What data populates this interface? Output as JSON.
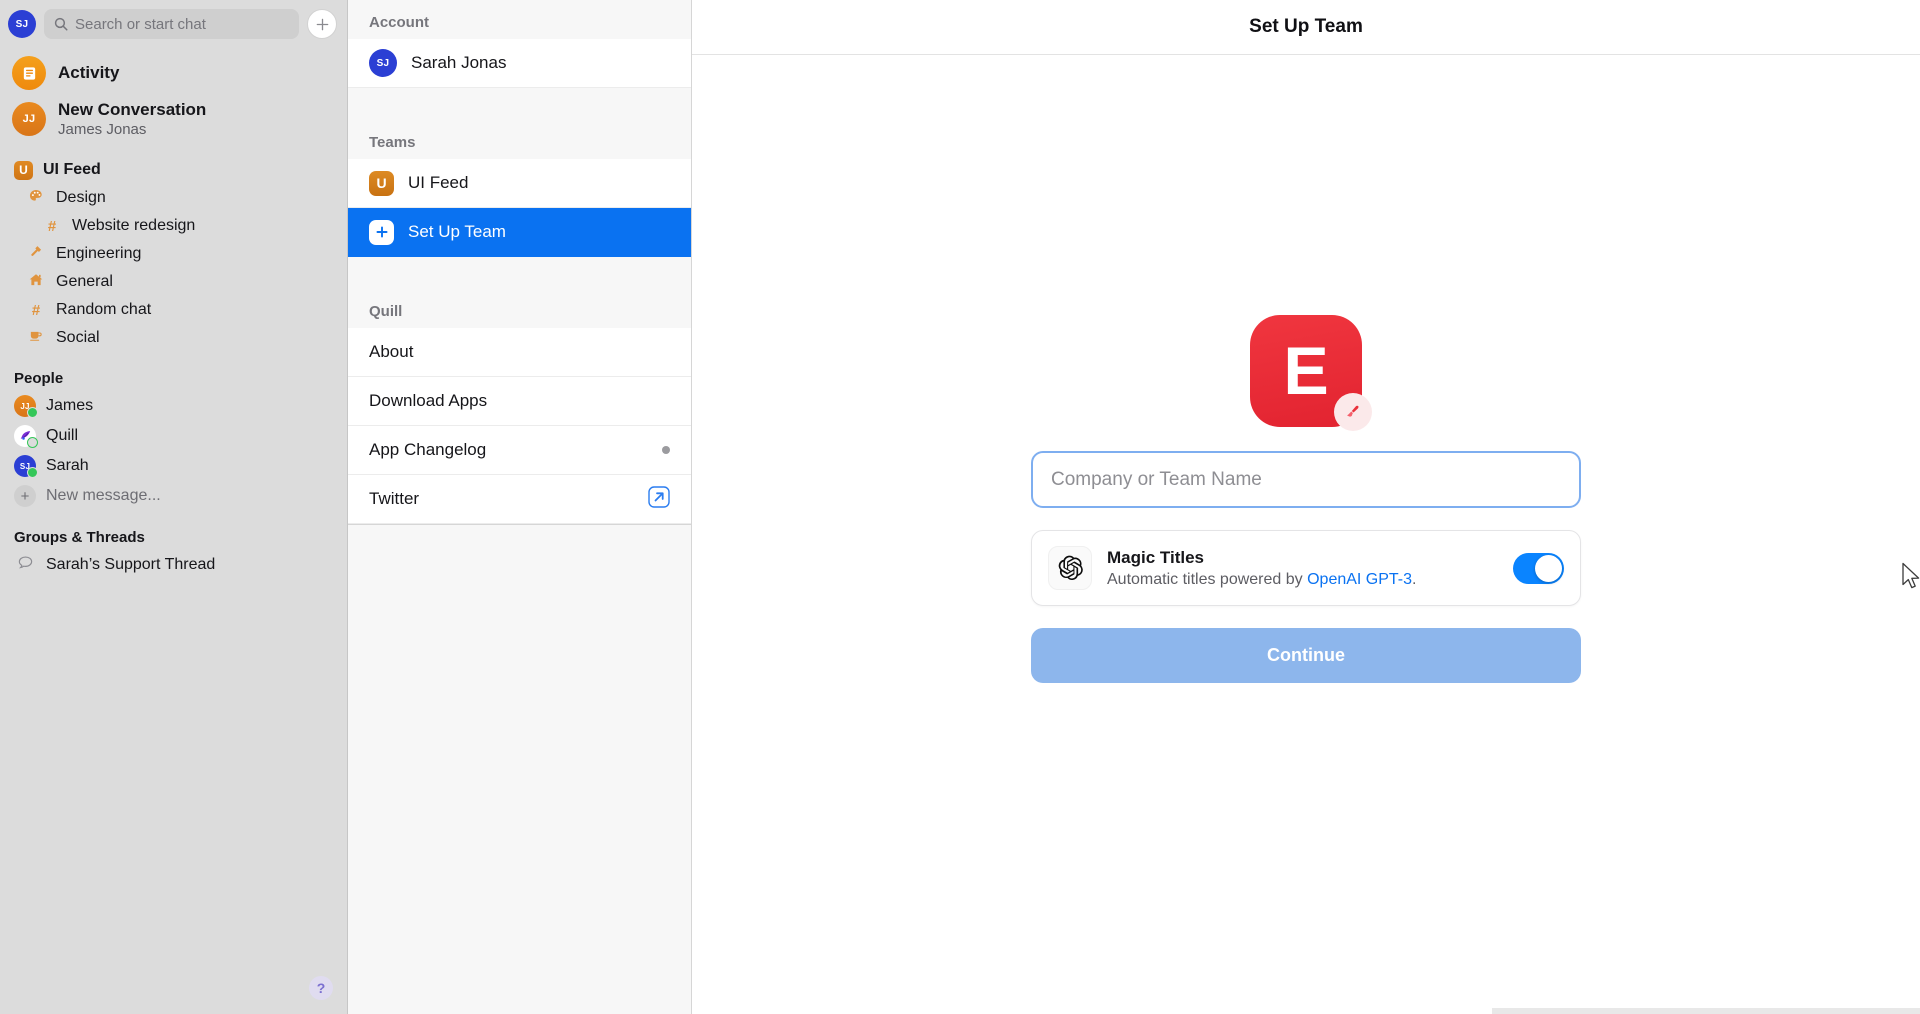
{
  "sidebar": {
    "account_initials": "SJ",
    "search": {
      "placeholder": "Search or start chat",
      "icon": "search-icon"
    },
    "new_chat_icon": "plus-icon",
    "conversations": [
      {
        "initials": "",
        "icon": "activity-icon",
        "title": "Activity",
        "subtitle": ""
      },
      {
        "initials": "JJ",
        "icon": "",
        "title": "New Conversation",
        "subtitle": "James Jonas"
      }
    ],
    "team": {
      "badge": "U",
      "name": "UI Feed"
    },
    "channels": [
      {
        "icon": "palette-icon",
        "glyph": "🎨",
        "label": "Design",
        "indent": 1
      },
      {
        "icon": "hash-icon",
        "glyph": "#",
        "label": "Website redesign",
        "indent": 2
      },
      {
        "icon": "hammer-icon",
        "glyph": "⚒",
        "label": "Engineering",
        "indent": 1
      },
      {
        "icon": "house-icon",
        "glyph": "🏠",
        "label": "General",
        "indent": 1
      },
      {
        "icon": "hash-icon",
        "glyph": "#",
        "label": "Random chat",
        "indent": 1
      },
      {
        "icon": "coffee-icon",
        "glyph": "☕",
        "label": "Social",
        "indent": 1
      }
    ],
    "people_header": "People",
    "people": [
      {
        "initials": "JJ",
        "name": "James",
        "presence": "online",
        "avatar_style": "orange"
      },
      {
        "initials": "",
        "name": "Quill",
        "presence": "away",
        "avatar_style": "quill"
      },
      {
        "initials": "SJ",
        "name": "Sarah",
        "presence": "online",
        "avatar_style": "blue"
      }
    ],
    "new_message": {
      "label": "New message...",
      "icon": "plus-icon"
    },
    "groups_header": "Groups & Threads",
    "groups": [
      {
        "icon": "speech-bubble-icon",
        "label": "Sarah’s Support Thread"
      }
    ],
    "help_button": "?"
  },
  "panel": {
    "account_header": "Account",
    "account_row": {
      "initials": "SJ",
      "name": "Sarah Jonas"
    },
    "teams_header": "Teams",
    "teams": [
      {
        "badge": "U",
        "label": "UI Feed",
        "selected": false,
        "badge_style": "orange"
      },
      {
        "badge": "+",
        "label": "Set Up Team",
        "selected": true,
        "badge_style": "white"
      }
    ],
    "quill_header": "Quill",
    "quill_items": [
      {
        "label": "About",
        "trailing": ""
      },
      {
        "label": "Download Apps",
        "trailing": ""
      },
      {
        "label": "App Changelog",
        "trailing": "dot"
      },
      {
        "label": "Twitter",
        "trailing": "external-link"
      }
    ]
  },
  "main": {
    "title": "Set Up Team",
    "logo_letter": "E",
    "logo_color": "#e9313c",
    "edit_badge_icon": "paintbrush-icon",
    "team_name_input": {
      "value": "",
      "placeholder": "Company or Team Name"
    },
    "magic": {
      "icon": "openai-logo-icon",
      "title": "Magic Titles",
      "subtitle_prefix": "Automatic titles powered by ",
      "subtitle_link": "OpenAI GPT-3",
      "subtitle_suffix": ".",
      "toggle_on": true,
      "accent": "#0a84ff"
    },
    "continue_label": "Continue"
  }
}
